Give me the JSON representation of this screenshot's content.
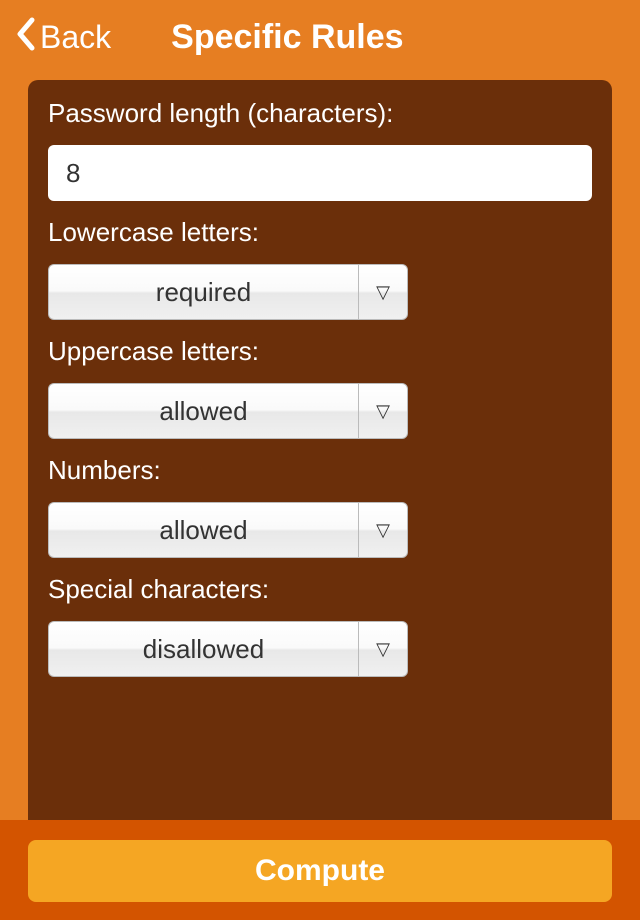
{
  "header": {
    "back_label": "Back",
    "title": "Specific Rules"
  },
  "form": {
    "length_label": "Password length (characters):",
    "length_value": "8",
    "lowercase_label": "Lowercase letters:",
    "lowercase_value": "required",
    "uppercase_label": "Uppercase letters:",
    "uppercase_value": "allowed",
    "numbers_label": "Numbers:",
    "numbers_value": "allowed",
    "special_label": "Special characters:",
    "special_value": "disallowed"
  },
  "footer": {
    "compute_label": "Compute"
  }
}
